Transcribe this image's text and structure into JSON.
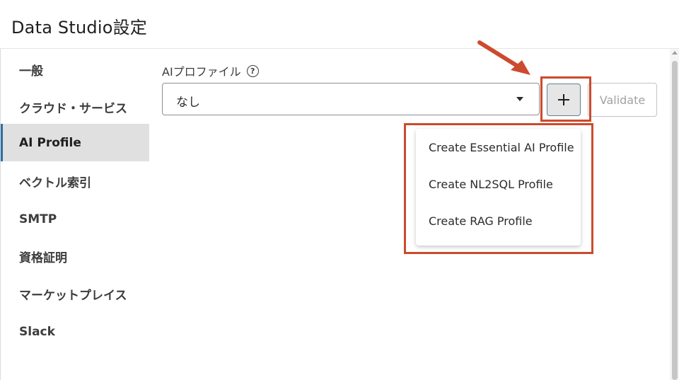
{
  "header": {
    "title": "Data Studio設定"
  },
  "sidebar": {
    "items": [
      {
        "label": "一般"
      },
      {
        "label": "クラウド・サービス"
      },
      {
        "label": "AI Profile"
      },
      {
        "label": "ベクトル索引"
      },
      {
        "label": "SMTP"
      },
      {
        "label": "資格証明"
      },
      {
        "label": "マーケットプレイス"
      },
      {
        "label": "Slack"
      }
    ],
    "active_index": 2
  },
  "main": {
    "field_label": "AIプロファイル",
    "help_icon_glyph": "?",
    "select": {
      "value": "なし"
    },
    "add_button_icon": "plus-icon",
    "validate_label": "Validate",
    "menu": {
      "items": [
        {
          "label": "Create Essential AI Profile"
        },
        {
          "label": "Create NL2SQL Profile"
        },
        {
          "label": "Create RAG Profile"
        }
      ]
    }
  },
  "annotations": {
    "color": "#cc4a2d"
  },
  "colors": {
    "active_nav_bg": "#e0e0e0",
    "active_nav_border": "#2d6fa3",
    "button_gray_bg": "#e6e6e6"
  }
}
